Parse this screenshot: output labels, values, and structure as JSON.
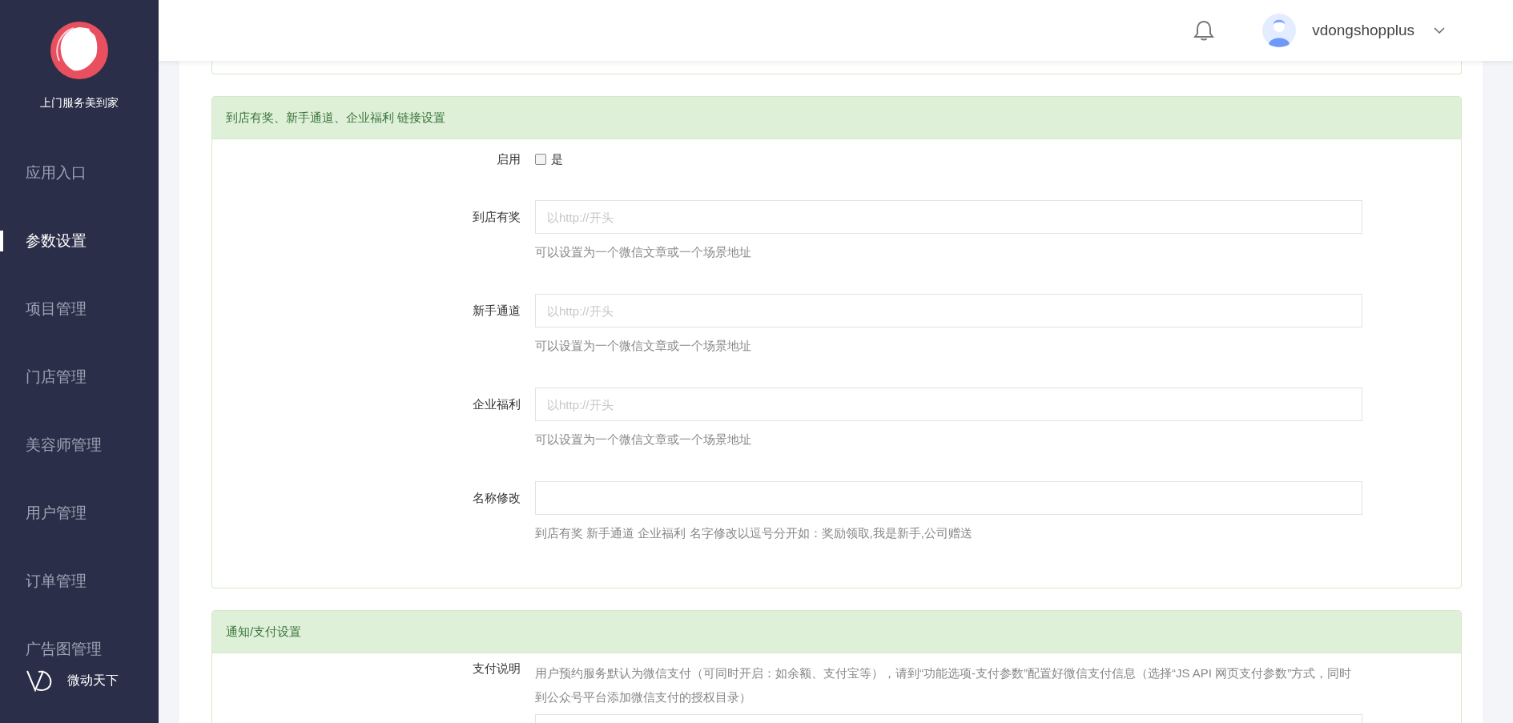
{
  "sidebar": {
    "brand": "上门服务美到家",
    "items": [
      {
        "label": "应用入口",
        "selected": false
      },
      {
        "label": "参数设置",
        "selected": true
      },
      {
        "label": "项目管理",
        "selected": false
      },
      {
        "label": "门店管理",
        "selected": false
      },
      {
        "label": "美容师管理",
        "selected": false
      },
      {
        "label": "用户管理",
        "selected": false
      },
      {
        "label": "订单管理",
        "selected": false
      },
      {
        "label": "广告图管理",
        "selected": false
      }
    ],
    "footer_brand": "微动天下"
  },
  "header": {
    "username": "vdongshopplus"
  },
  "sections": [
    {
      "title": "到店有奖、新手通道、企业福利 链接设置",
      "rows": [
        {
          "kind": "checkbox",
          "label": "启用",
          "option": "是",
          "checked": false
        },
        {
          "kind": "input",
          "label": "到店有奖",
          "placeholder": "以http://开头",
          "help": "可以设置为一个微信文章或一个场景地址"
        },
        {
          "kind": "input",
          "label": "新手通道",
          "placeholder": "以http://开头",
          "help": "可以设置为一个微信文章或一个场景地址"
        },
        {
          "kind": "input",
          "label": "企业福利",
          "placeholder": "以http://开头",
          "help": "可以设置为一个微信文章或一个场景地址"
        },
        {
          "kind": "input",
          "label": "名称修改",
          "help": "到店有奖 新手通道 企业福利 名字修改以逗号分开如：奖励领取,我是新手,公司赠送"
        }
      ]
    },
    {
      "title": "通知/支付设置",
      "rows": [
        {
          "kind": "note",
          "label": "支付说明",
          "text": "用户预约服务默认为微信支付（可同时开启：如余额、支付宝等），请到“功能选项-支付参数”配置好微信支付信息（选择“JS API 网页支付参数”方式，同时到公众号平台添加微信支付的授权目录）"
        },
        {
          "kind": "input"
        }
      ]
    }
  ]
}
